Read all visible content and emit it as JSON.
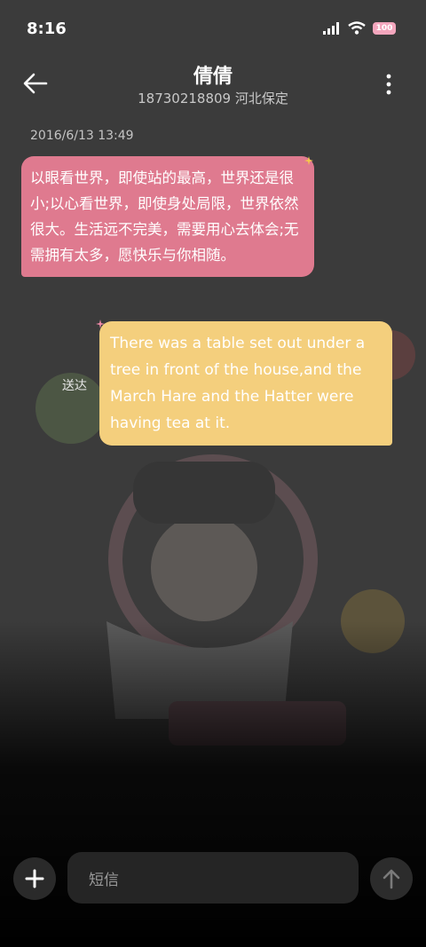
{
  "status_bar": {
    "time": "8:16",
    "battery": "100"
  },
  "header": {
    "contact_name": "倩倩",
    "contact_detail": "18730218809 河北保定"
  },
  "conversation": {
    "timestamp": "2016/6/13 13:49",
    "incoming_message": "以眼看世界，即使站的最高，世界还是很小;以心看世界，即使身处局限，世界依然很大。生活远不完美，需要用心去体会;无需拥有太多，愿快乐与你相随。",
    "outgoing_message": "There was a table set out under a tree in front of the house,and the March Hare and the Hatter were having tea at it.",
    "delivery_status": "送达"
  },
  "composer": {
    "placeholder": "短信"
  },
  "colors": {
    "incoming_bubble": "#df7a8f",
    "outgoing_bubble": "#f4cf7d",
    "background": "#3b3b3b"
  },
  "icons": [
    "back-arrow-icon",
    "more-vertical-icon",
    "plus-icon",
    "send-arrow-icon",
    "signal-icon",
    "wifi-icon"
  ]
}
